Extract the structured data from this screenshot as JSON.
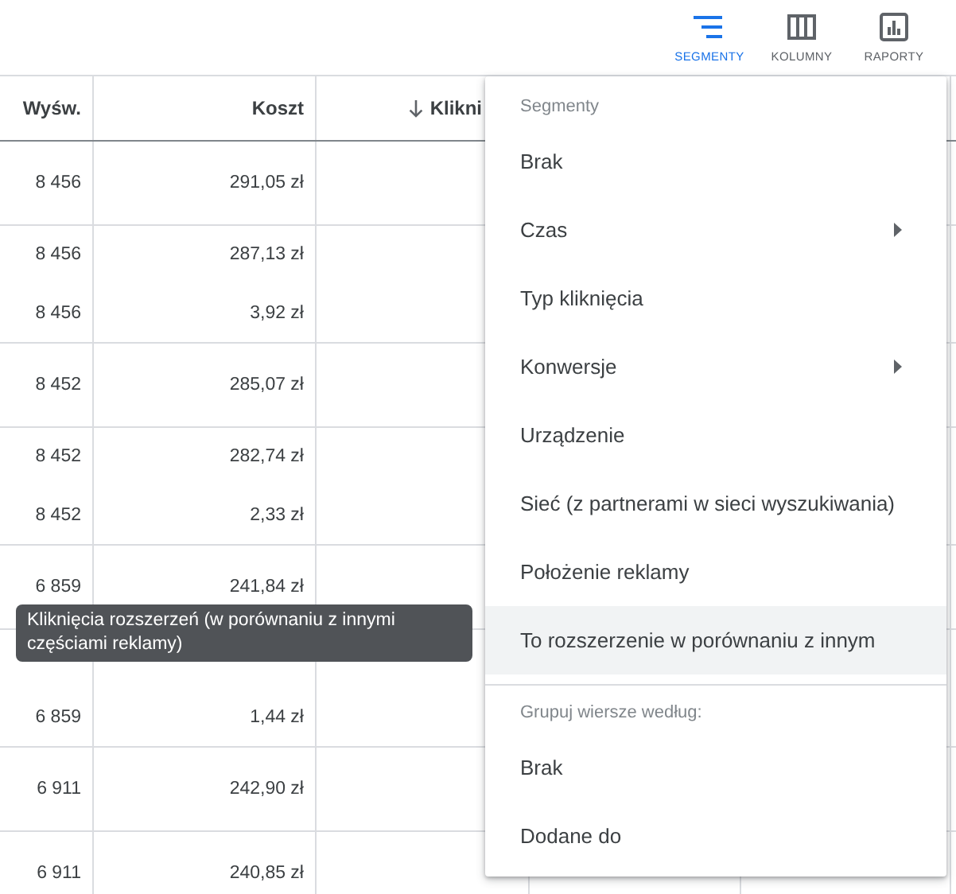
{
  "toolbar": [
    {
      "label": "SEGMENTY",
      "active": true
    },
    {
      "label": "KOLUMNY",
      "active": false
    },
    {
      "label": "RAPORTY",
      "active": false
    }
  ],
  "table": {
    "columns": [
      {
        "label": "Wyśw.",
        "sorted": false
      },
      {
        "label": "Koszt",
        "sorted": false
      },
      {
        "label": "Klikni",
        "sorted": true
      }
    ],
    "groups": [
      {
        "rows": [
          [
            "8 456",
            "291,05 zł"
          ]
        ]
      },
      {
        "rows": [
          [
            "8 456",
            "287,13 zł"
          ],
          [
            "8 456",
            "3,92 zł"
          ]
        ]
      },
      {
        "rows": [
          [
            "8 452",
            "285,07 zł"
          ]
        ]
      },
      {
        "rows": [
          [
            "8 452",
            "282,74 zł"
          ],
          [
            "8 452",
            "2,33 zł"
          ]
        ]
      },
      {
        "rows": [
          [
            "6 859",
            "241,84 zł"
          ]
        ]
      },
      {
        "rows": [
          {
            "kind": "covered"
          },
          [
            "6 859",
            "1,44 zł"
          ]
        ]
      },
      {
        "rows": [
          [
            "6 911",
            "242,90 zł"
          ]
        ]
      },
      {
        "rows": [
          [
            "6 911",
            "240,85 zł"
          ]
        ]
      }
    ]
  },
  "menu": {
    "sections": [
      {
        "title": "Segmenty",
        "items": [
          {
            "label": "Brak",
            "submenu": false,
            "highlighted": false
          },
          {
            "label": "Czas",
            "submenu": true,
            "highlighted": false
          },
          {
            "label": "Typ kliknięcia",
            "submenu": false,
            "highlighted": false
          },
          {
            "label": "Konwersje",
            "submenu": true,
            "highlighted": false
          },
          {
            "label": "Urządzenie",
            "submenu": false,
            "highlighted": false
          },
          {
            "label": "Sieć (z partnerami w sieci wyszukiwania)",
            "submenu": false,
            "highlighted": false
          },
          {
            "label": "Położenie reklamy",
            "submenu": false,
            "highlighted": false
          },
          {
            "label": "To rozszerzenie w porównaniu z innym",
            "submenu": false,
            "highlighted": true
          }
        ]
      },
      {
        "title": "Grupuj wiersze według:",
        "items": [
          {
            "label": "Brak",
            "submenu": false,
            "highlighted": false
          },
          {
            "label": "Dodane do",
            "submenu": false,
            "highlighted": false
          }
        ]
      }
    ]
  },
  "tooltip": {
    "text": "Kliknięcia rozszerzeń (w porównaniu z innymi częściami reklamy)"
  }
}
